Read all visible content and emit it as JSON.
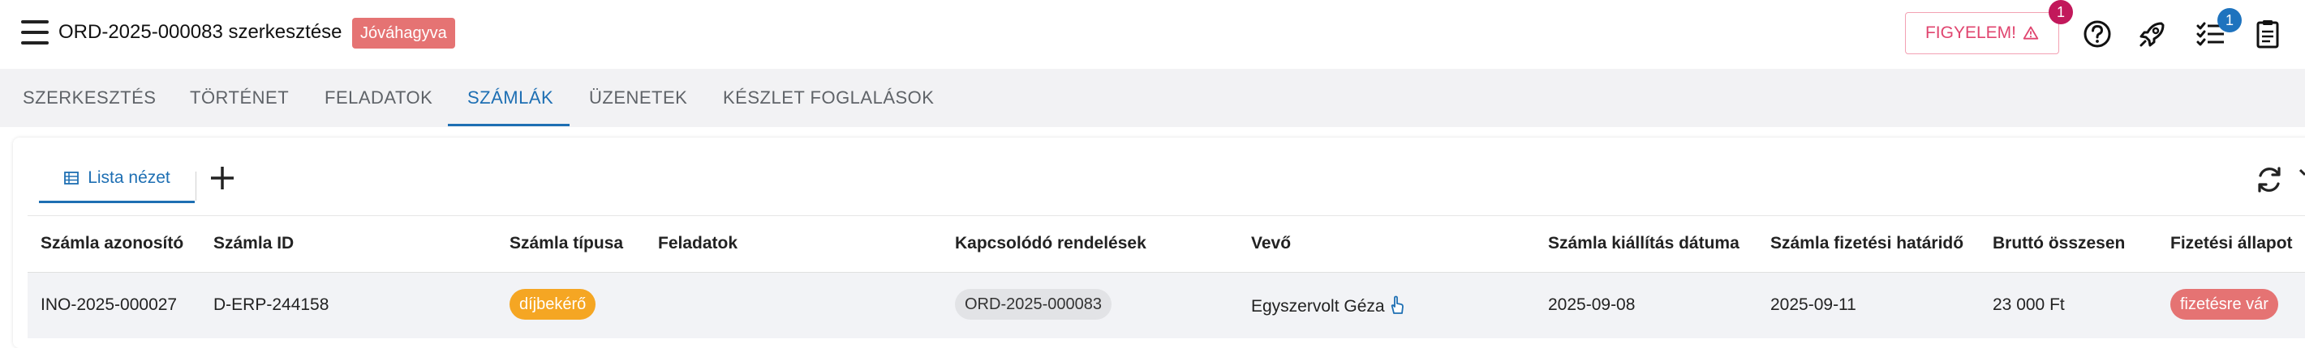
{
  "header": {
    "title": "ORD-2025-000083 szerkesztése",
    "status": "Jóváhagyva",
    "warning_label": "FIGYELEM!",
    "warning_badge": "1",
    "tasks_badge": "1",
    "icons": [
      "menu-icon",
      "help-icon",
      "rocket-icon",
      "task-list-icon",
      "clipboard-icon"
    ]
  },
  "tabs": [
    {
      "label": "SZERKESZTÉS"
    },
    {
      "label": "TÖRTÉNET"
    },
    {
      "label": "FELADATOK"
    },
    {
      "label": "SZÁMLÁK"
    },
    {
      "label": "ÜZENETEK"
    },
    {
      "label": "KÉSZLET FOGLALÁSOK"
    }
  ],
  "active_tab": "SZÁMLÁK",
  "toolbar": {
    "list_view_label": "Lista nézet"
  },
  "table": {
    "columns": [
      "Számla azonosító",
      "Számla ID",
      "Számla típusa",
      "Feladatok",
      "Kapcsolódó rendelések",
      "Vevő",
      "Számla kiállítás dátuma",
      "Számla fizetési határidő",
      "Bruttó összesen",
      "Fizetési állapot"
    ],
    "rows": [
      {
        "invoice_code": "INO-2025-000027",
        "invoice_id": "D-ERP-244158",
        "type": "díjbekérő",
        "tasks": "",
        "related_order": "ORD-2025-000083",
        "customer": "Egyszervolt Géza",
        "issue_date": "2025-09-08",
        "due_date": "2025-09-11",
        "gross_total": "23 000 Ft",
        "payment_status": "fizetésre vár"
      }
    ]
  },
  "colors": {
    "accent": "#1e6fb3",
    "status_chip": "#e57373",
    "warning": "#e0456f",
    "type_pill": "#f5a623",
    "payment_pill": "#e57373"
  }
}
